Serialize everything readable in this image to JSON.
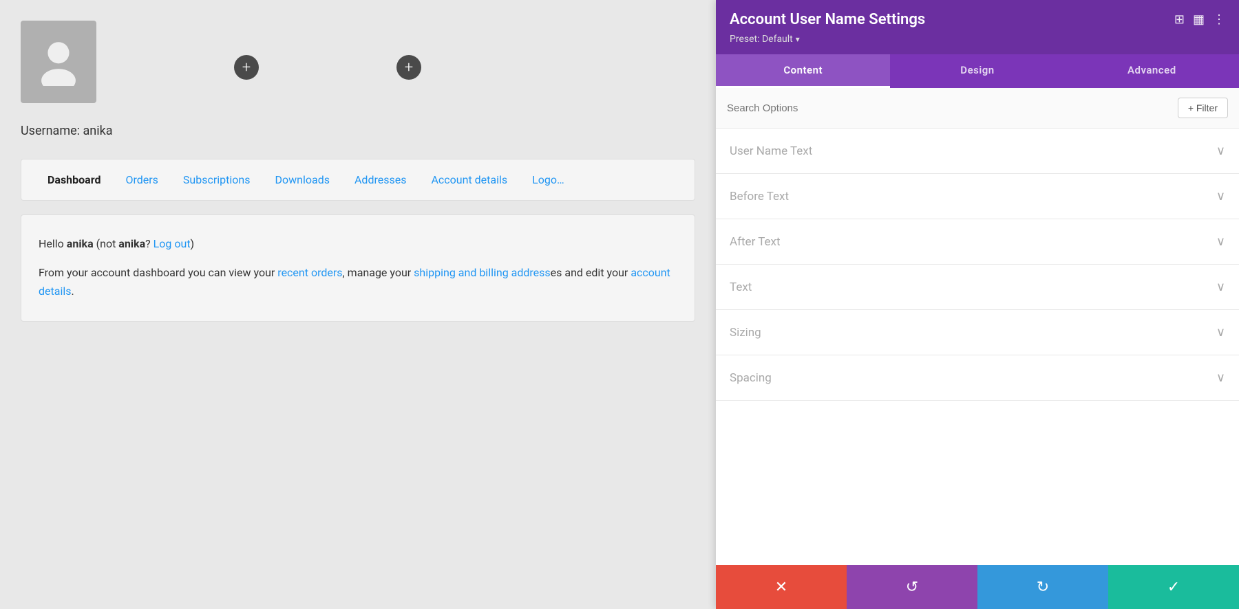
{
  "panel": {
    "title": "Account User Name Settings",
    "preset_label": "Preset: Default",
    "preset_arrow": "▾",
    "tabs": [
      {
        "id": "content",
        "label": "Content",
        "active": true
      },
      {
        "id": "design",
        "label": "Design",
        "active": false
      },
      {
        "id": "advanced",
        "label": "Advanced",
        "active": false
      }
    ],
    "search_placeholder": "Search Options",
    "filter_label": "+ Filter",
    "accordion_items": [
      {
        "id": "user-name-text",
        "label": "User Name Text"
      },
      {
        "id": "before-text",
        "label": "Before Text"
      },
      {
        "id": "after-text",
        "label": "After Text"
      },
      {
        "id": "text",
        "label": "Text"
      },
      {
        "id": "sizing",
        "label": "Sizing"
      },
      {
        "id": "spacing",
        "label": "Spacing"
      }
    ],
    "toolbar": {
      "cancel_icon": "✕",
      "undo_icon": "↺",
      "redo_icon": "↻",
      "save_icon": "✓"
    }
  },
  "main": {
    "username": "Username: anika",
    "nav_tabs": [
      {
        "id": "dashboard",
        "label": "Dashboard",
        "active": true
      },
      {
        "id": "orders",
        "label": "Orders",
        "active": false
      },
      {
        "id": "subscriptions",
        "label": "Subscriptions",
        "active": false
      },
      {
        "id": "downloads",
        "label": "Downloads",
        "active": false
      },
      {
        "id": "addresses",
        "label": "Addresses",
        "active": false
      },
      {
        "id": "account-details",
        "label": "Account details",
        "active": false
      },
      {
        "id": "logout",
        "label": "Logo…",
        "active": false
      }
    ],
    "welcome": {
      "greeting_prefix": "Hello ",
      "username": "anika",
      "not_text": " (not ",
      "username2": "anika",
      "logout_text": "? Log out",
      "logout_suffix": ")",
      "desc_prefix": "From your account dashboard you can view your ",
      "recent_orders_link": "recent orders",
      "desc_mid": ", manage your ",
      "address_link": "shipping and billing address",
      "desc_suffix": "es",
      "account_link": "account details",
      "desc_end": "."
    }
  }
}
